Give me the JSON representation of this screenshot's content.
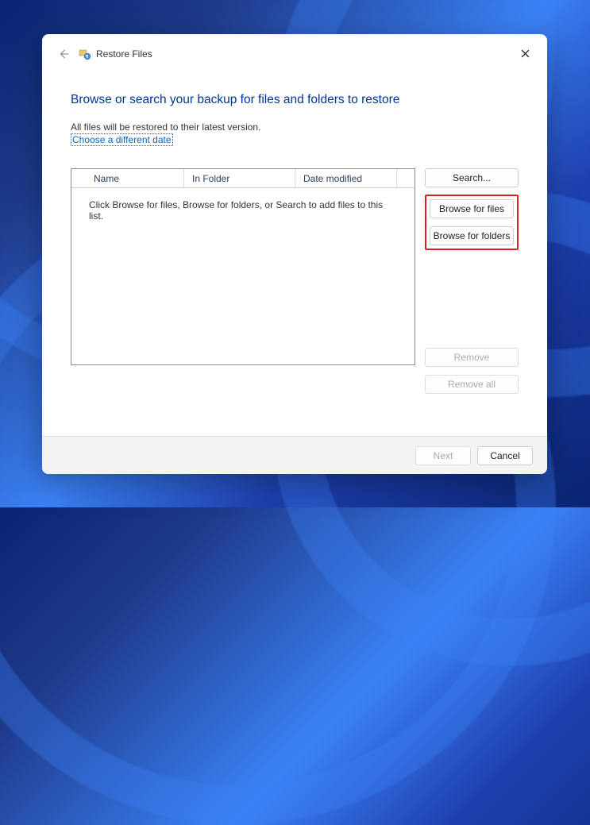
{
  "window": {
    "title": "Restore Files"
  },
  "heading": "Browse or search your backup for files and folders to restore",
  "info": "All files will be restored to their latest version.",
  "date_link": "Choose a different date",
  "columns": {
    "name": "Name",
    "in_folder": "In Folder",
    "date_modified": "Date modified"
  },
  "empty_message": "Click Browse for files, Browse for folders, or Search to add files to this list.",
  "buttons": {
    "search": "Search...",
    "browse_files": "Browse for files",
    "browse_folders": "Browse for folders",
    "remove": "Remove",
    "remove_all": "Remove all",
    "next": "Next",
    "cancel": "Cancel"
  }
}
